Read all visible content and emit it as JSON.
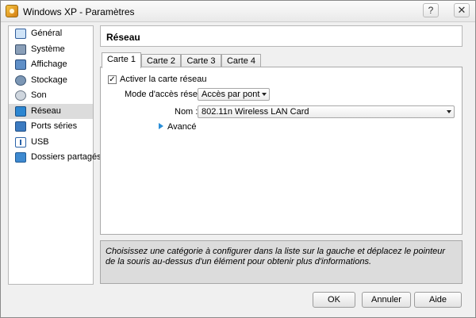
{
  "window": {
    "title": "Windows XP - Paramètres",
    "help_label": "?",
    "close_label": "✕"
  },
  "sidebar": {
    "items": [
      {
        "label": "Général",
        "icon": "general-icon"
      },
      {
        "label": "Système",
        "icon": "system-icon"
      },
      {
        "label": "Affichage",
        "icon": "display-icon"
      },
      {
        "label": "Stockage",
        "icon": "storage-icon"
      },
      {
        "label": "Son",
        "icon": "audio-icon"
      },
      {
        "label": "Réseau",
        "icon": "network-icon",
        "selected": true
      },
      {
        "label": "Ports séries",
        "icon": "serial-ports-icon"
      },
      {
        "label": "USB",
        "icon": "usb-icon"
      },
      {
        "label": "Dossiers partagés",
        "icon": "shared-folders-icon"
      }
    ]
  },
  "main": {
    "title": "Réseau",
    "tabs": [
      {
        "label": "Carte 1",
        "active": true
      },
      {
        "label": "Carte 2"
      },
      {
        "label": "Carte 3"
      },
      {
        "label": "Carte 4"
      }
    ],
    "enable_adapter": {
      "label": "Activer la carte réseau",
      "checked": true,
      "mark": "✓"
    },
    "attached_to": {
      "label": "Mode d'accès réseau :",
      "value": "Accès par pont"
    },
    "name": {
      "label": "Nom :",
      "value": "802.11n Wireless LAN Card"
    },
    "advanced_label": "Avancé"
  },
  "info_text": "Choisissez une catégorie à configurer dans la liste sur la gauche et déplacez le pointeur de la souris au-dessus d'un élément pour obtenir plus d'informations.",
  "buttons": {
    "ok": "OK",
    "cancel": "Annuler",
    "help": "Aide"
  }
}
